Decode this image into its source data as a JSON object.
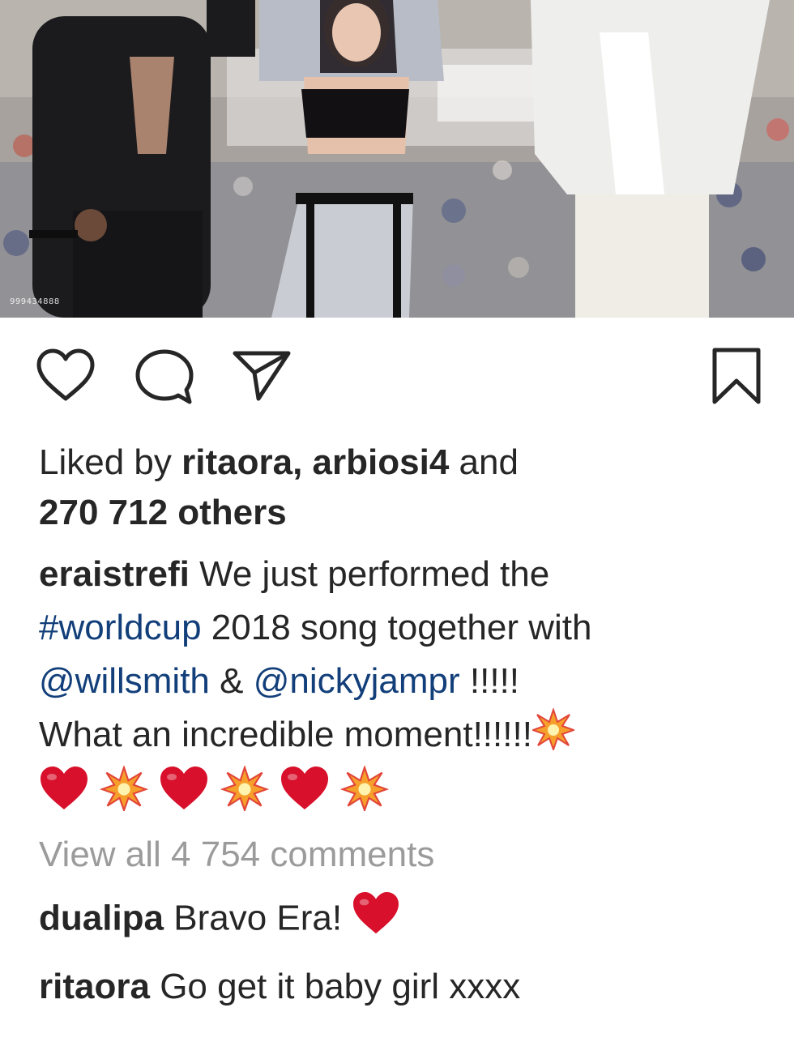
{
  "photo": {
    "watermark": "999434888"
  },
  "actions": {
    "like_icon": "heart-outline-icon",
    "comment_icon": "speech-bubble-icon",
    "share_icon": "paper-plane-icon",
    "save_icon": "bookmark-icon"
  },
  "likes": {
    "prefix": "Liked by",
    "user1": "ritaora",
    "sep": ",",
    "user2": "arbiosi4",
    "and": "and",
    "others": "270 712 others"
  },
  "caption": {
    "username": "eraistrefi",
    "text1": "We just performed the",
    "hashtag": "#worldcup",
    "text2": "2018 song together with",
    "mention1": "@willsmith",
    "amp": "&",
    "mention2": "@nickyjampr",
    "text3": "!!!!!",
    "text4": "What an incredible moment!!!!!!"
  },
  "view_all": "View all 4 754 comments",
  "comments": [
    {
      "username": "dualipa",
      "text": "Bravo Era!"
    },
    {
      "username": "ritaora",
      "text": "Go get it baby girl xxxx"
    }
  ],
  "colors": {
    "link": "#123f7a",
    "muted": "#9b9b9b",
    "text": "#262626",
    "heart": "#d8102b",
    "burst": "#f6a02b"
  }
}
